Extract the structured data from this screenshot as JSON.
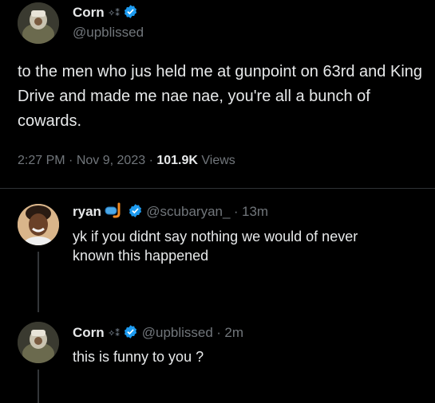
{
  "main_tweet": {
    "author_name": "Corn",
    "author_sparkles": "✧⁑",
    "author_handle": "@upblissed",
    "text": "to the men who jus held me at gunpoint on 63rd and King Drive and made me nae nae, you're all a bunch of cowards.",
    "time": "2:27 PM",
    "date": "Nov 9, 2023",
    "views_count": "101.9K",
    "views_label": "Views",
    "separator": "·"
  },
  "replies": [
    {
      "author_name": "ryan",
      "author_handle": "@scubaryan_",
      "age": "13m",
      "separator": "·",
      "text_line1": "yk if you didnt say nothing we would of never",
      "text_line2": "known this happened"
    },
    {
      "author_name": "Corn",
      "author_sparkles": "✧⁑",
      "author_handle": "@upblissed",
      "age": "2m",
      "separator": "·",
      "text": "this is funny to you ?"
    }
  ],
  "icons": {
    "verified": "verified-badge-icon",
    "snorkel": "snorkel-emoji-icon"
  },
  "colors": {
    "background": "#000000",
    "text": "#e7e9ea",
    "muted": "#71767b",
    "verified": "#1d9bf0"
  }
}
